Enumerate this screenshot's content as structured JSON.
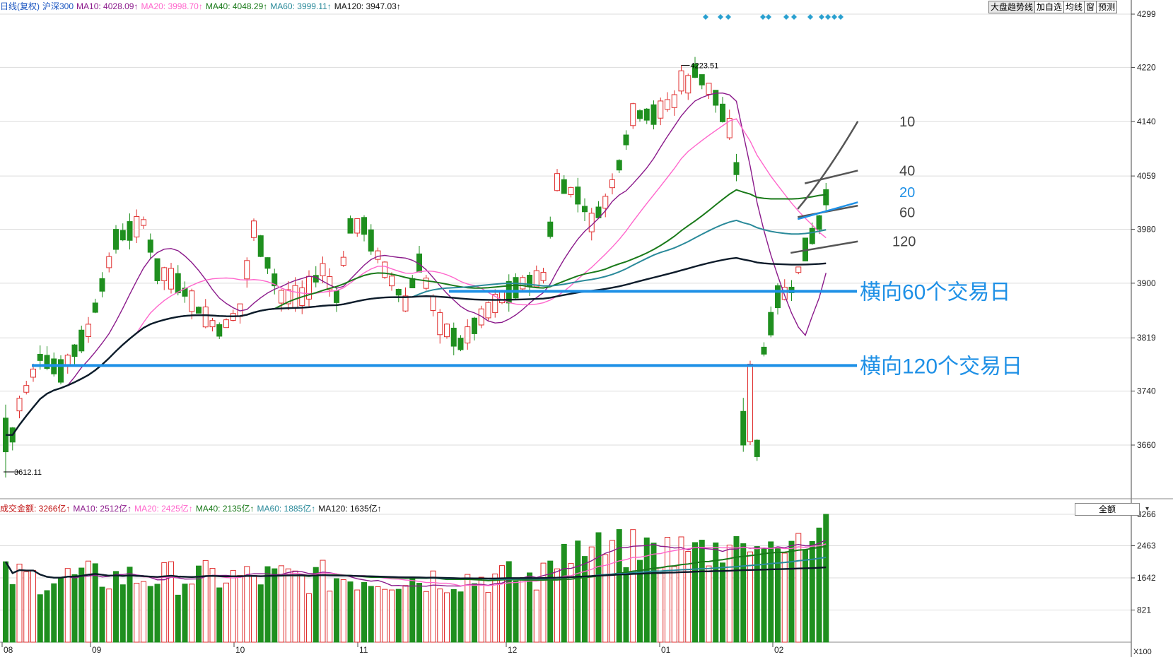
{
  "header": {
    "period_label": "日线(复权)",
    "symbol": "沪深300",
    "ma_items": [
      {
        "label": "MA10: 4028.09↑",
        "color": "#8b1a8b"
      },
      {
        "label": "MA20: 3998.70↑",
        "color": "#ff66cc"
      },
      {
        "label": "MA40: 4048.29↑",
        "color": "#1a7a1a"
      },
      {
        "label": "MA60: 3999.11↑",
        "color": "#2a8a9a"
      },
      {
        "label": "MA120: 3947.03↑",
        "color": "#111111"
      }
    ]
  },
  "toolbar": [
    "大盘趋势线",
    "加自选",
    "均线",
    "窗",
    "预测"
  ],
  "volume_header": {
    "label": "成交金额: 3266亿↑",
    "ma_items": [
      {
        "label": "MA10: 2512亿↑",
        "color": "#8b1a8b"
      },
      {
        "label": "MA20: 2425亿↑",
        "color": "#ff66cc"
      },
      {
        "label": "MA40: 2135亿↑",
        "color": "#1a7a1a"
      },
      {
        "label": "MA60: 1885亿↑",
        "color": "#2a8a9a"
      },
      {
        "label": "MA120: 1635亿↑",
        "color": "#111111"
      }
    ],
    "selector": "全额"
  },
  "annotations": {
    "h60": "横向60个交易日",
    "h120": "横向120个交易日",
    "lbl10": "10",
    "lbl40": "40",
    "lbl20": "20",
    "lbl60": "60",
    "lbl120": "120",
    "high": "4223.51",
    "low": "3612.11"
  },
  "chart_data": {
    "type": "candlestick",
    "price_axis": {
      "ticks": [
        3660,
        3740,
        3819,
        3900,
        3980,
        4059,
        4140,
        4220,
        4299
      ]
    },
    "volume_axis": {
      "ticks": [
        821,
        1642,
        2463,
        3266
      ],
      "unit": "X100"
    },
    "month_labels": [
      "08",
      "09",
      "10",
      "11",
      "12",
      "01",
      "02"
    ],
    "colors": {
      "up": "#e03030",
      "down": "#1f8f1f",
      "blue": "#1e90e6"
    }
  }
}
